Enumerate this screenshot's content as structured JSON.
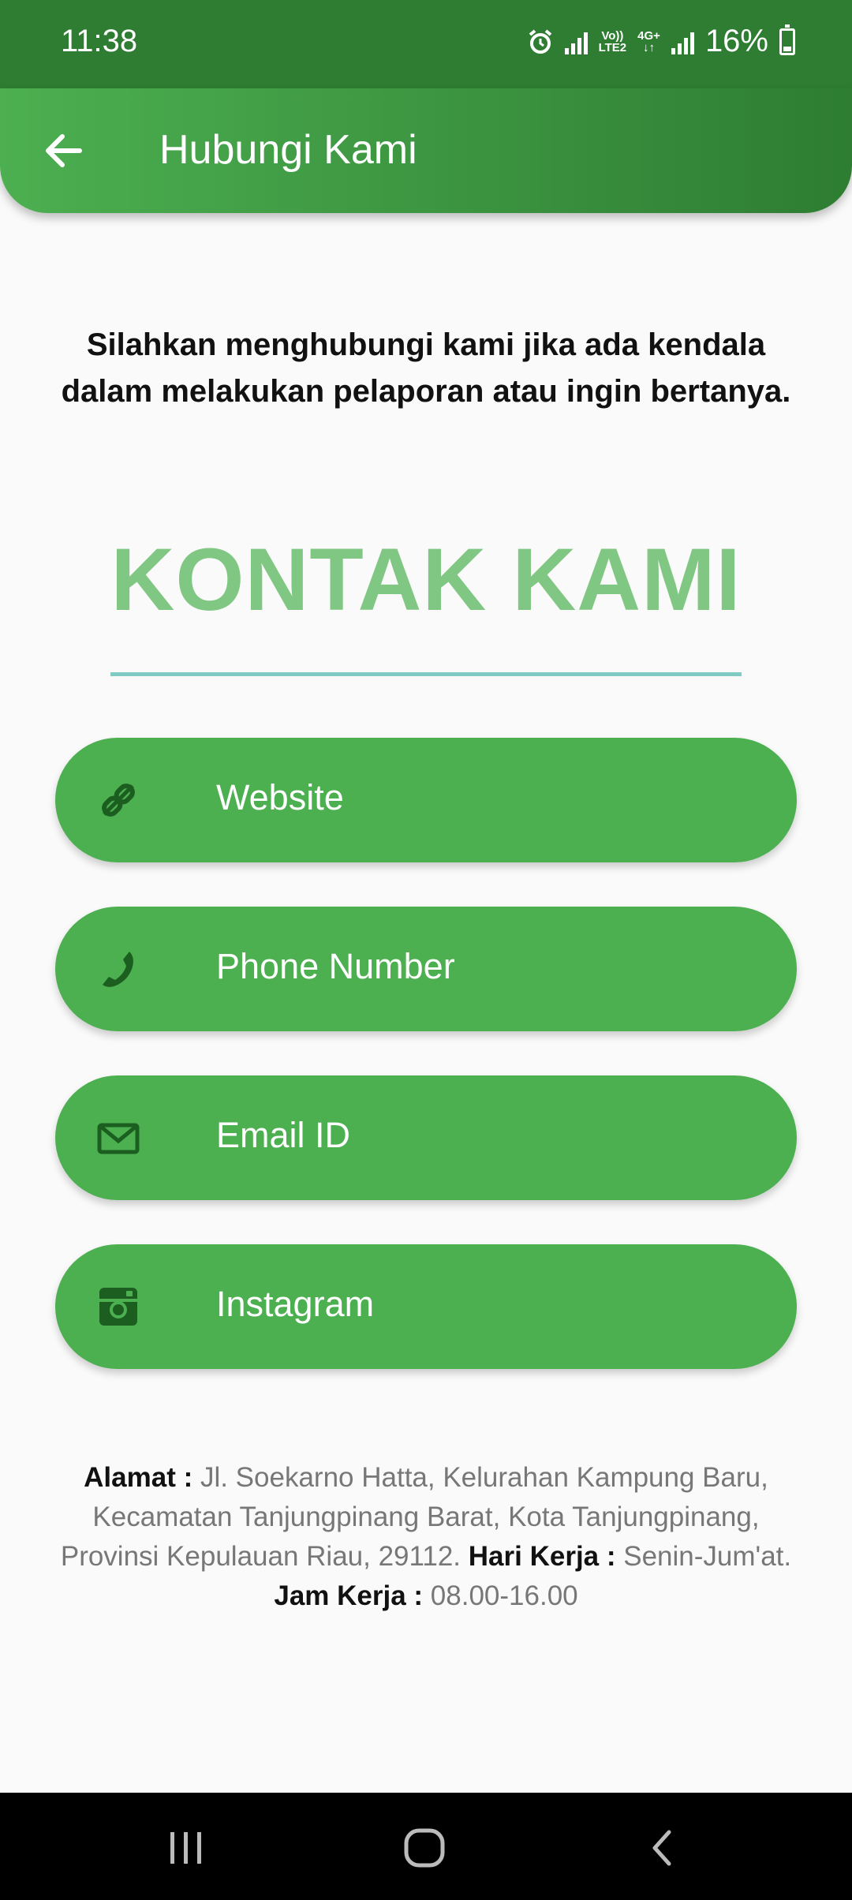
{
  "status_bar": {
    "time": "11:38",
    "volte": "Vo))",
    "lte": "LTE2",
    "network": "4G+",
    "battery": "16%",
    "icons": [
      "alarm-icon",
      "signal-icon",
      "volte-icon",
      "data-4g-icon",
      "signal-icon",
      "battery-icon"
    ]
  },
  "app_bar": {
    "title": "Hubungi Kami",
    "back_icon": "arrow-left-icon"
  },
  "intro_text": "Silahkan menghubungi kami jika ada kendala dalam melakukan pelaporan atau ingin bertanya.",
  "heading": "KONTAK KAMI",
  "contacts": [
    {
      "label": "Website",
      "icon": "link-icon"
    },
    {
      "label": "Phone Number",
      "icon": "phone-icon"
    },
    {
      "label": "Email ID",
      "icon": "mail-icon"
    },
    {
      "label": "Instagram",
      "icon": "instagram-icon"
    }
  ],
  "address": {
    "label": "Alamat :",
    "value": " Jl. Soekarno Hatta, Kelurahan Kampung Baru, Kecamatan Tanjungpinang Barat, Kota Tanjungpinang, Provinsi Kepulauan Riau, 29112.",
    "hours_label": " Hari Kerja :",
    "hours_value": " Senin-Jum'at.",
    "time_label": "Jam Kerja :",
    "time_value": " 08.00-16.00"
  },
  "colors": {
    "app_bar_start": "#4caf50",
    "app_bar_end": "#2e7d32",
    "button": "#4caf50",
    "heading": "#81c784",
    "divider": "#80cbc4",
    "icon": "#1b5e20"
  },
  "nav_bar": {
    "icons": [
      "recents-icon",
      "home-icon",
      "back-icon"
    ]
  }
}
